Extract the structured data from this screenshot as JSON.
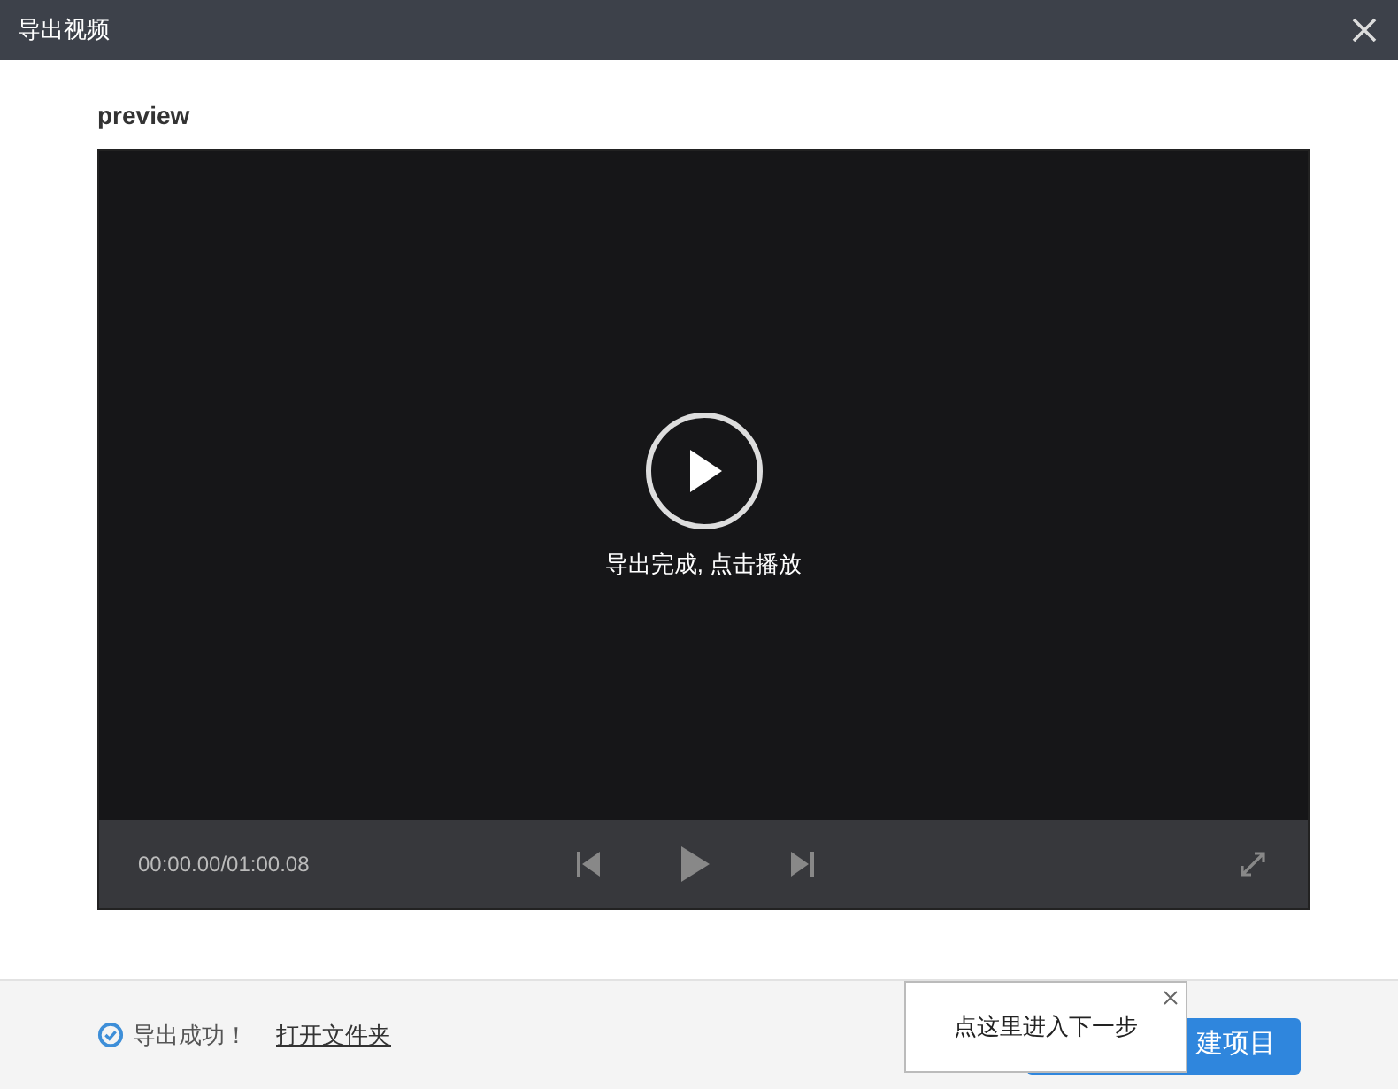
{
  "window": {
    "title": "导出视频"
  },
  "preview": {
    "label": "preview",
    "message": "导出完成, 点击播放",
    "time": "00:00.00/01:00.08"
  },
  "footer": {
    "status": "导出成功！",
    "link": "打开文件夹",
    "button": "建项目"
  },
  "tooltip": {
    "text": "点这里进入下一步"
  }
}
